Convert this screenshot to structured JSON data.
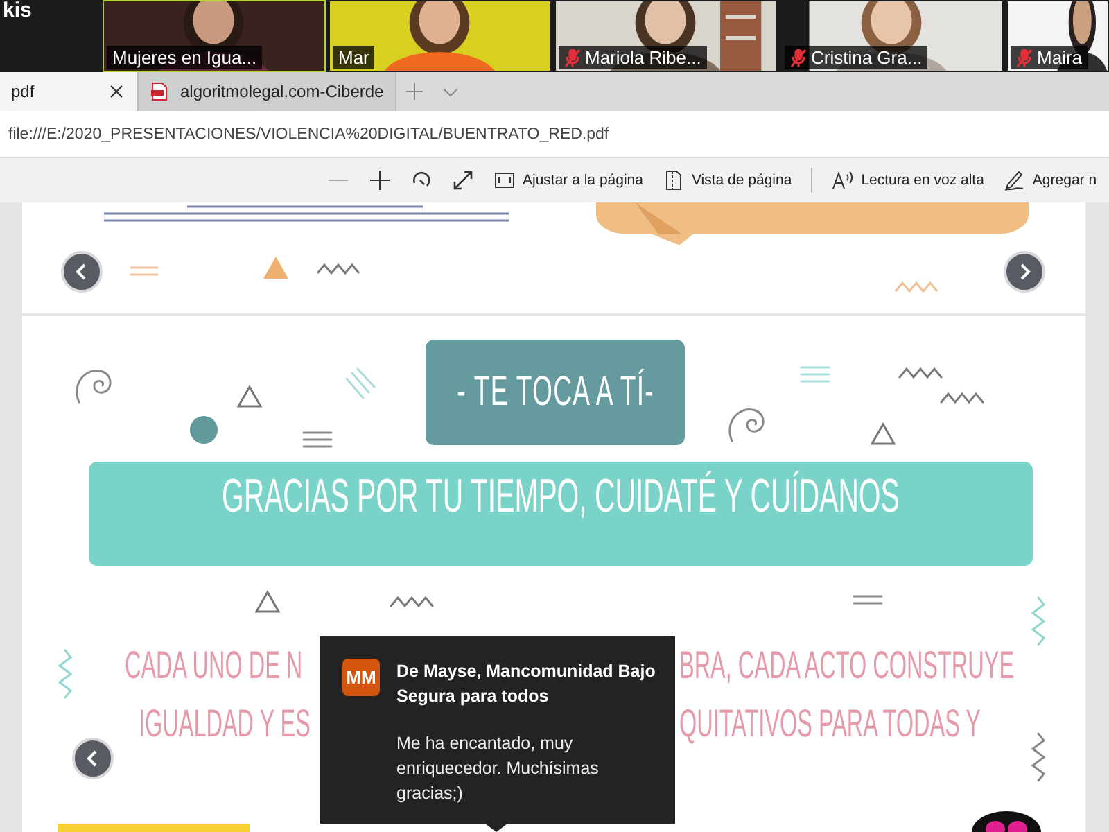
{
  "video_strip": {
    "cut_label": "kis",
    "participants": [
      {
        "name": "Mujeres en Igua...",
        "muted": false,
        "active_speaker": true
      },
      {
        "name": "Mar",
        "muted": false,
        "active_speaker": false
      },
      {
        "name": "Mariola Ribe...",
        "muted": true,
        "active_speaker": false
      },
      {
        "name": "Cristina Gra...",
        "muted": true,
        "active_speaker": false
      },
      {
        "name": "Maira",
        "muted": true,
        "active_speaker": false
      }
    ]
  },
  "browser": {
    "tabs": [
      {
        "label": "pdf",
        "selected": true
      },
      {
        "label": "algoritmolegal.com-Ciberde",
        "selected": false
      }
    ],
    "address": "file:///E:/2020_PRESENTACIONES/VIOLENCIA%20DIGITAL/BUENTRATO_RED.pdf"
  },
  "pdf_toolbar": {
    "labels": [
      "Ajustar a la página",
      "Vista de página",
      "Lectura en voz alta",
      "Agregar n"
    ]
  },
  "slide": {
    "tag": "- TE TOCA A TÍ-",
    "banner": "GRACIAS POR TU TIEMPO, CUIDATÉ Y CUÍDANOS",
    "body_fragments": [
      "CADA UNO DE N",
      "BRA, CADA ACTO CONSTRUYE",
      "IGUALDAD Y ES",
      "QUITATIVOS PARA TODAS Y"
    ]
  },
  "notification": {
    "initials": "MM",
    "sender": "De Mayse, Mancomunidad Bajo Segura para todos",
    "message": "Me ha encantado, muy enriquecedor. Muchísimas gracias;)"
  }
}
